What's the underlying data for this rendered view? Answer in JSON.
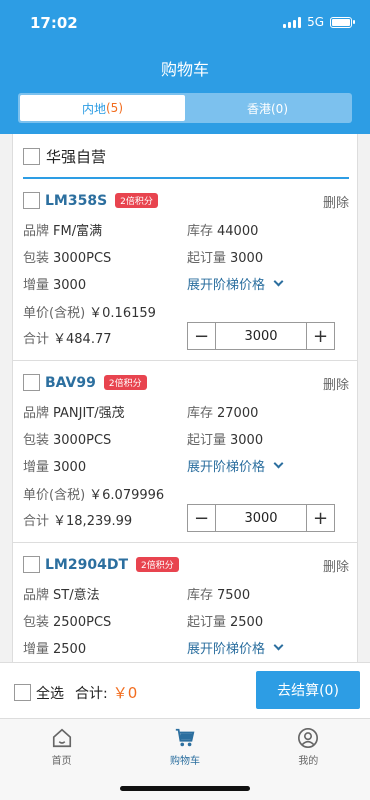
{
  "status_bar": {
    "time": "17:02",
    "network": "5G"
  },
  "page_title": "购物车",
  "tabs": [
    {
      "label": "内地",
      "count": "(5)",
      "active": true
    },
    {
      "label": "香港(0)",
      "active": false
    }
  ],
  "store": {
    "name": "华强自营"
  },
  "labels": {
    "brand": "品牌",
    "stock": "库存",
    "package": "包装",
    "moq": "起订量",
    "increment": "增量",
    "unit_price": "单价(含税)",
    "subtotal": "合计",
    "expand": "展开阶梯价格",
    "delete": "删除"
  },
  "products": [
    {
      "name": "LM358S",
      "badge": "2倍积分",
      "brand": "FM/富满",
      "stock": "44000",
      "package": "3000PCS",
      "moq": "3000",
      "increment": "3000",
      "unit_price": "￥0.16159",
      "subtotal": "￥484.77",
      "quantity": "3000"
    },
    {
      "name": "BAV99",
      "badge": "2倍积分",
      "brand": "PANJIT/强茂",
      "stock": "27000",
      "package": "3000PCS",
      "moq": "3000",
      "increment": "3000",
      "unit_price": "￥6.079996",
      "subtotal": "￥18,239.99",
      "quantity": "3000"
    },
    {
      "name": "LM2904DT",
      "badge": "2倍积分",
      "brand": "ST/意法",
      "stock": "7500",
      "package": "2500PCS",
      "moq": "2500",
      "increment": "2500"
    }
  ],
  "footer": {
    "select_all": "全选",
    "total_label": "合计:",
    "total_value": "￥0",
    "checkout": "去结算(0)"
  },
  "tabbar": [
    {
      "label": "首页",
      "icon": "home-icon"
    },
    {
      "label": "购物车",
      "icon": "cart-icon",
      "active": true
    },
    {
      "label": "我的",
      "icon": "user-icon"
    }
  ],
  "colors": {
    "primary": "#2d9de4",
    "accent": "#f26d1f",
    "badge": "#e8444f",
    "link": "#2c6f9f"
  }
}
